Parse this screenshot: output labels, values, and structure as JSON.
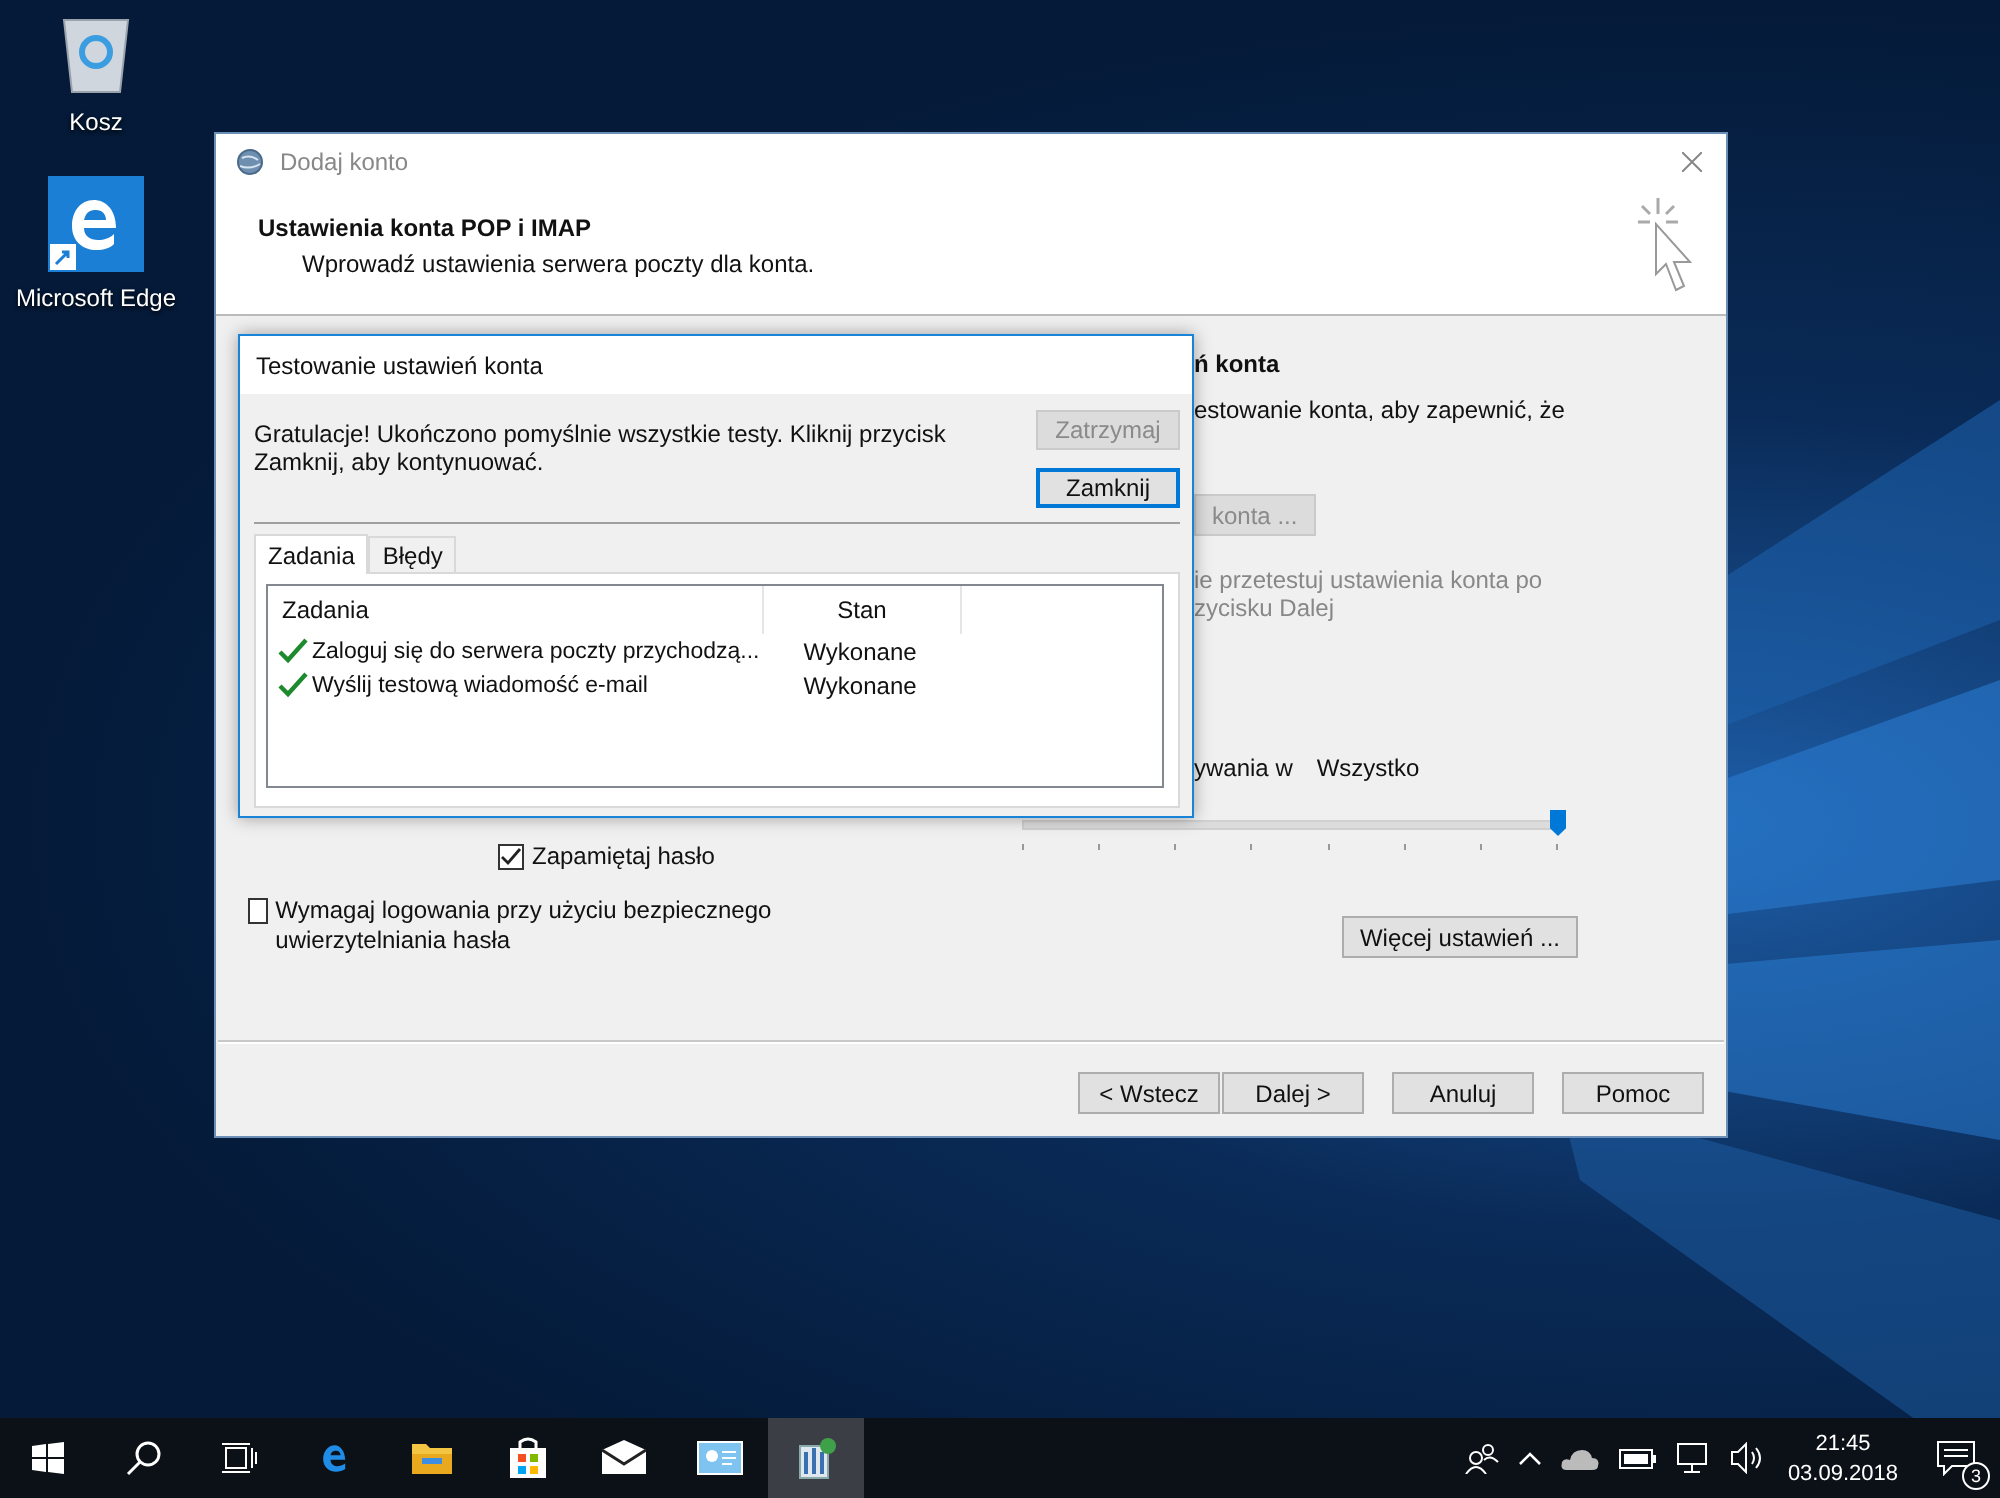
{
  "desktop_icons": [
    {
      "label": "Kosz",
      "kind": "recycle-bin"
    },
    {
      "label": "Microsoft Edge",
      "kind": "edge"
    }
  ],
  "main_dialog": {
    "title": "Dodaj konto",
    "heading": "Ustawienia konta POP i IMAP",
    "subheading": "Wprowadź ustawienia serwera poczty dla konta.",
    "section_heading": "ń konta",
    "section_text": "estowanie konta, aby zapewnić, że",
    "test_button": {
      "label": "konta ...",
      "disabled": true
    },
    "hint_lines": [
      "ie przetestuj ustawienia konta po",
      "zycisku Dalej"
    ],
    "offline_label": "ywania w",
    "offline_value": "Wszystko",
    "offline_slider": {
      "level": 1
    },
    "remember_password": {
      "label": "Zapamiętaj hasło",
      "checked": true
    },
    "secure_auth": {
      "label": "Wymagaj logowania przy użyciu bezpiecznego uwierzytelniania hasła",
      "checked": false
    },
    "more_settings_button": "Więcej ustawień ...",
    "buttons": [
      "< Wstecz",
      "Dalej >",
      "Anuluj",
      "Pomoc"
    ]
  },
  "test_dialog": {
    "title": "Testowanie ustawień konta",
    "message": "Gratulacje! Ukończono pomyślnie wszystkie testy. Kliknij przycisk Zamknij, aby kontynuować.",
    "buttons": [
      {
        "label": "Zatrzymaj",
        "disabled": true,
        "default": false
      },
      {
        "label": "Zamknij",
        "disabled": false,
        "default": true
      }
    ],
    "tabs": [
      {
        "label": "Zadania",
        "selected": true
      },
      {
        "label": "Błędy",
        "selected": false
      }
    ],
    "columns": [
      "Zadania",
      "Stan"
    ],
    "rows": [
      {
        "task": "Zaloguj się do serwera poczty przychodzą...",
        "status": "Wykonane",
        "done": true
      },
      {
        "task": "Wyślij testową wiadomość e-mail",
        "status": "Wykonane",
        "done": true
      }
    ]
  },
  "taskbar": {
    "items": [
      {
        "kind": "start",
        "active": false
      },
      {
        "kind": "search",
        "active": false
      },
      {
        "kind": "task-view",
        "active": false
      },
      {
        "kind": "edge",
        "active": false
      },
      {
        "kind": "explorer",
        "active": false
      },
      {
        "kind": "store",
        "active": false
      },
      {
        "kind": "mail",
        "active": false
      },
      {
        "kind": "app",
        "active": false
      },
      {
        "kind": "setup",
        "active": true
      }
    ],
    "time": "21:45",
    "date": "03.09.2018",
    "notification_count": "3"
  }
}
